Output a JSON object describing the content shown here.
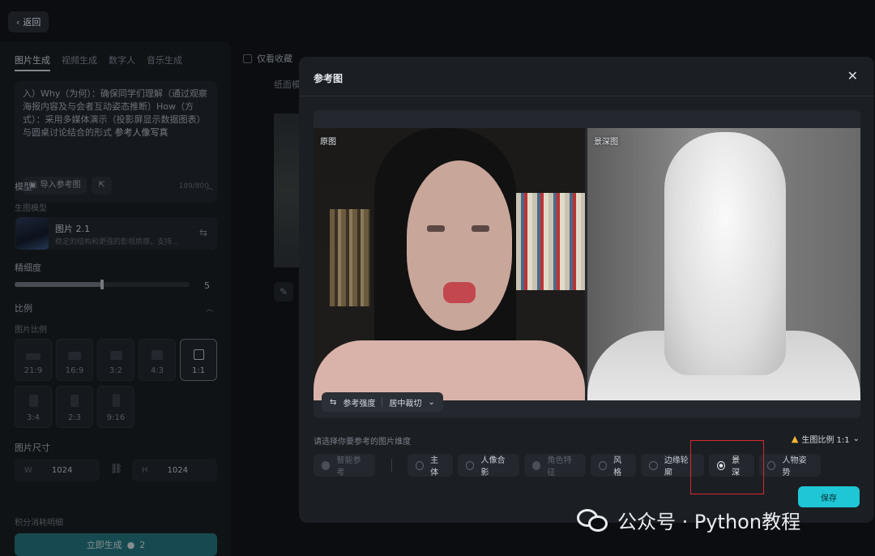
{
  "back_label": "返回",
  "left": {
    "tabs": [
      "图片生成",
      "视频生成",
      "数字人",
      "音乐生成"
    ],
    "prompt_text": "入）Why（为何）：确保同学们理解（通过观察海报内容及与会者互动姿态推断）How（方式）：采用多媒体演示（投影屏显示数据图表）与圆桌讨论结合的形式",
    "prompt_ref_tag": "参考人像写真",
    "import_ref_label": "导入参考图",
    "char_count": "189/800",
    "model_section": "模型",
    "model_sub": "生图模型",
    "model_name": "图片 2.1",
    "model_desc": "稳定的结构和更强的影视质感，支持...",
    "precision_label": "精细度",
    "precision_value": "5",
    "ratio_section": "比例",
    "ratio_sub": "图片比例",
    "ratios": [
      "21:9",
      "16:9",
      "3:2",
      "4:3",
      "1:1",
      "3:4",
      "2:3",
      "9:16"
    ],
    "size_label": "图片尺寸",
    "w_key": "W",
    "w_value": "1024",
    "h_key": "H",
    "h_value": "1024",
    "cost_label": "积分消耗明细",
    "generate_label": "立即生成",
    "generate_cost": "2"
  },
  "background": {
    "fav_label": "仅看收藏",
    "snippet": "纸面模"
  },
  "modal": {
    "title": "参考图",
    "orig_tag": "原图",
    "depth_tag": "景深图",
    "strength_label": "参考强度",
    "crop_label": "居中裁切",
    "hint": "请选择你要参考的图片维度",
    "ratio_label": "生图比例 1:1",
    "options": {
      "smart": "智能参考",
      "subject": "主体",
      "portrait": "人像合影",
      "character": "角色特征",
      "style": "风格",
      "edge": "边缘轮廓",
      "depth": "景深",
      "pose": "人物姿势"
    },
    "save_label": "保存"
  },
  "watermark": "公众号 · Python教程",
  "colors": {
    "accent": "#1fc6d6",
    "highlight_box": "#d9272e",
    "warning": "#f2b632"
  }
}
